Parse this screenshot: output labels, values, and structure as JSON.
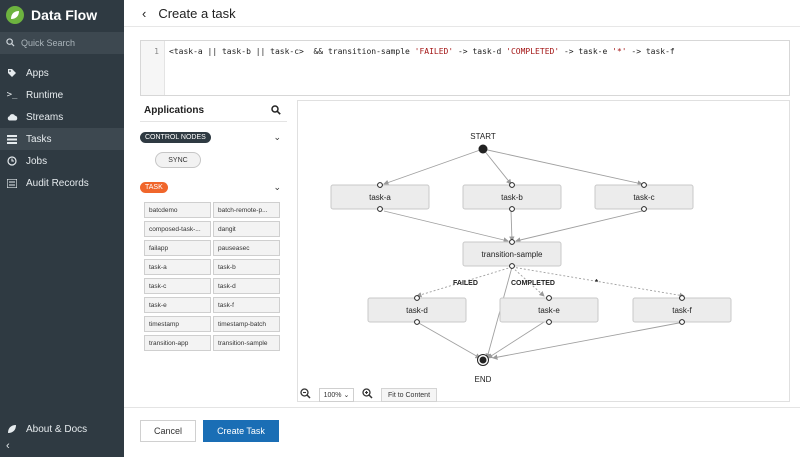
{
  "app": {
    "title": "Data Flow"
  },
  "search": {
    "placeholder": "Quick Search"
  },
  "nav": [
    {
      "label": "Apps",
      "icon": "tag-icon"
    },
    {
      "label": "Runtime",
      "icon": "terminal-icon"
    },
    {
      "label": "Streams",
      "icon": "cloud-icon"
    },
    {
      "label": "Tasks",
      "icon": "tasks-icon"
    },
    {
      "label": "Jobs",
      "icon": "clock-icon"
    },
    {
      "label": "Audit Records",
      "icon": "list-icon"
    }
  ],
  "about": {
    "label": "About & Docs"
  },
  "header": {
    "back": "‹",
    "title": "Create a task"
  },
  "editor": {
    "line": "1",
    "code_plain_1": "<task-a || task-b || task-c>  && transition-sample ",
    "str1": "'FAILED'",
    "code_plain_2": " -> task-d ",
    "str2": "'COMPLETED'",
    "code_plain_3": " -> task-e ",
    "str3": "'*'",
    "code_plain_4": " -> task-f"
  },
  "applications": {
    "title": "Applications",
    "control_nodes": "CONTROL NODES",
    "sync": "SYNC",
    "task_group": "TASK",
    "tasks": [
      "batcdemo",
      "batch-remote-p...",
      "composed-task-...",
      "dangit",
      "failapp",
      "pauseasec",
      "task-a",
      "task-b",
      "task-c",
      "task-d",
      "task-e",
      "task-f",
      "timestamp",
      "timestamp-batch",
      "transition-app",
      "transition-sample"
    ]
  },
  "graph": {
    "start": "START",
    "end": "END",
    "nodes": {
      "a": "task-a",
      "b": "task-b",
      "c": "task-c",
      "t": "transition-sample",
      "d": "task-d",
      "e": "task-e",
      "f": "task-f"
    },
    "labels": {
      "failed": "FAILED",
      "completed": "COMPLETED",
      "star": "*"
    }
  },
  "zoom": {
    "level": "100%",
    "fit": "Fit to Content"
  },
  "footer": {
    "cancel": "Cancel",
    "create": "Create Task"
  },
  "colors": {
    "sidebar": "#2f3a42",
    "primary": "#1a6eb5",
    "task_tag": "#f0662b",
    "brand": "#6db33f"
  }
}
